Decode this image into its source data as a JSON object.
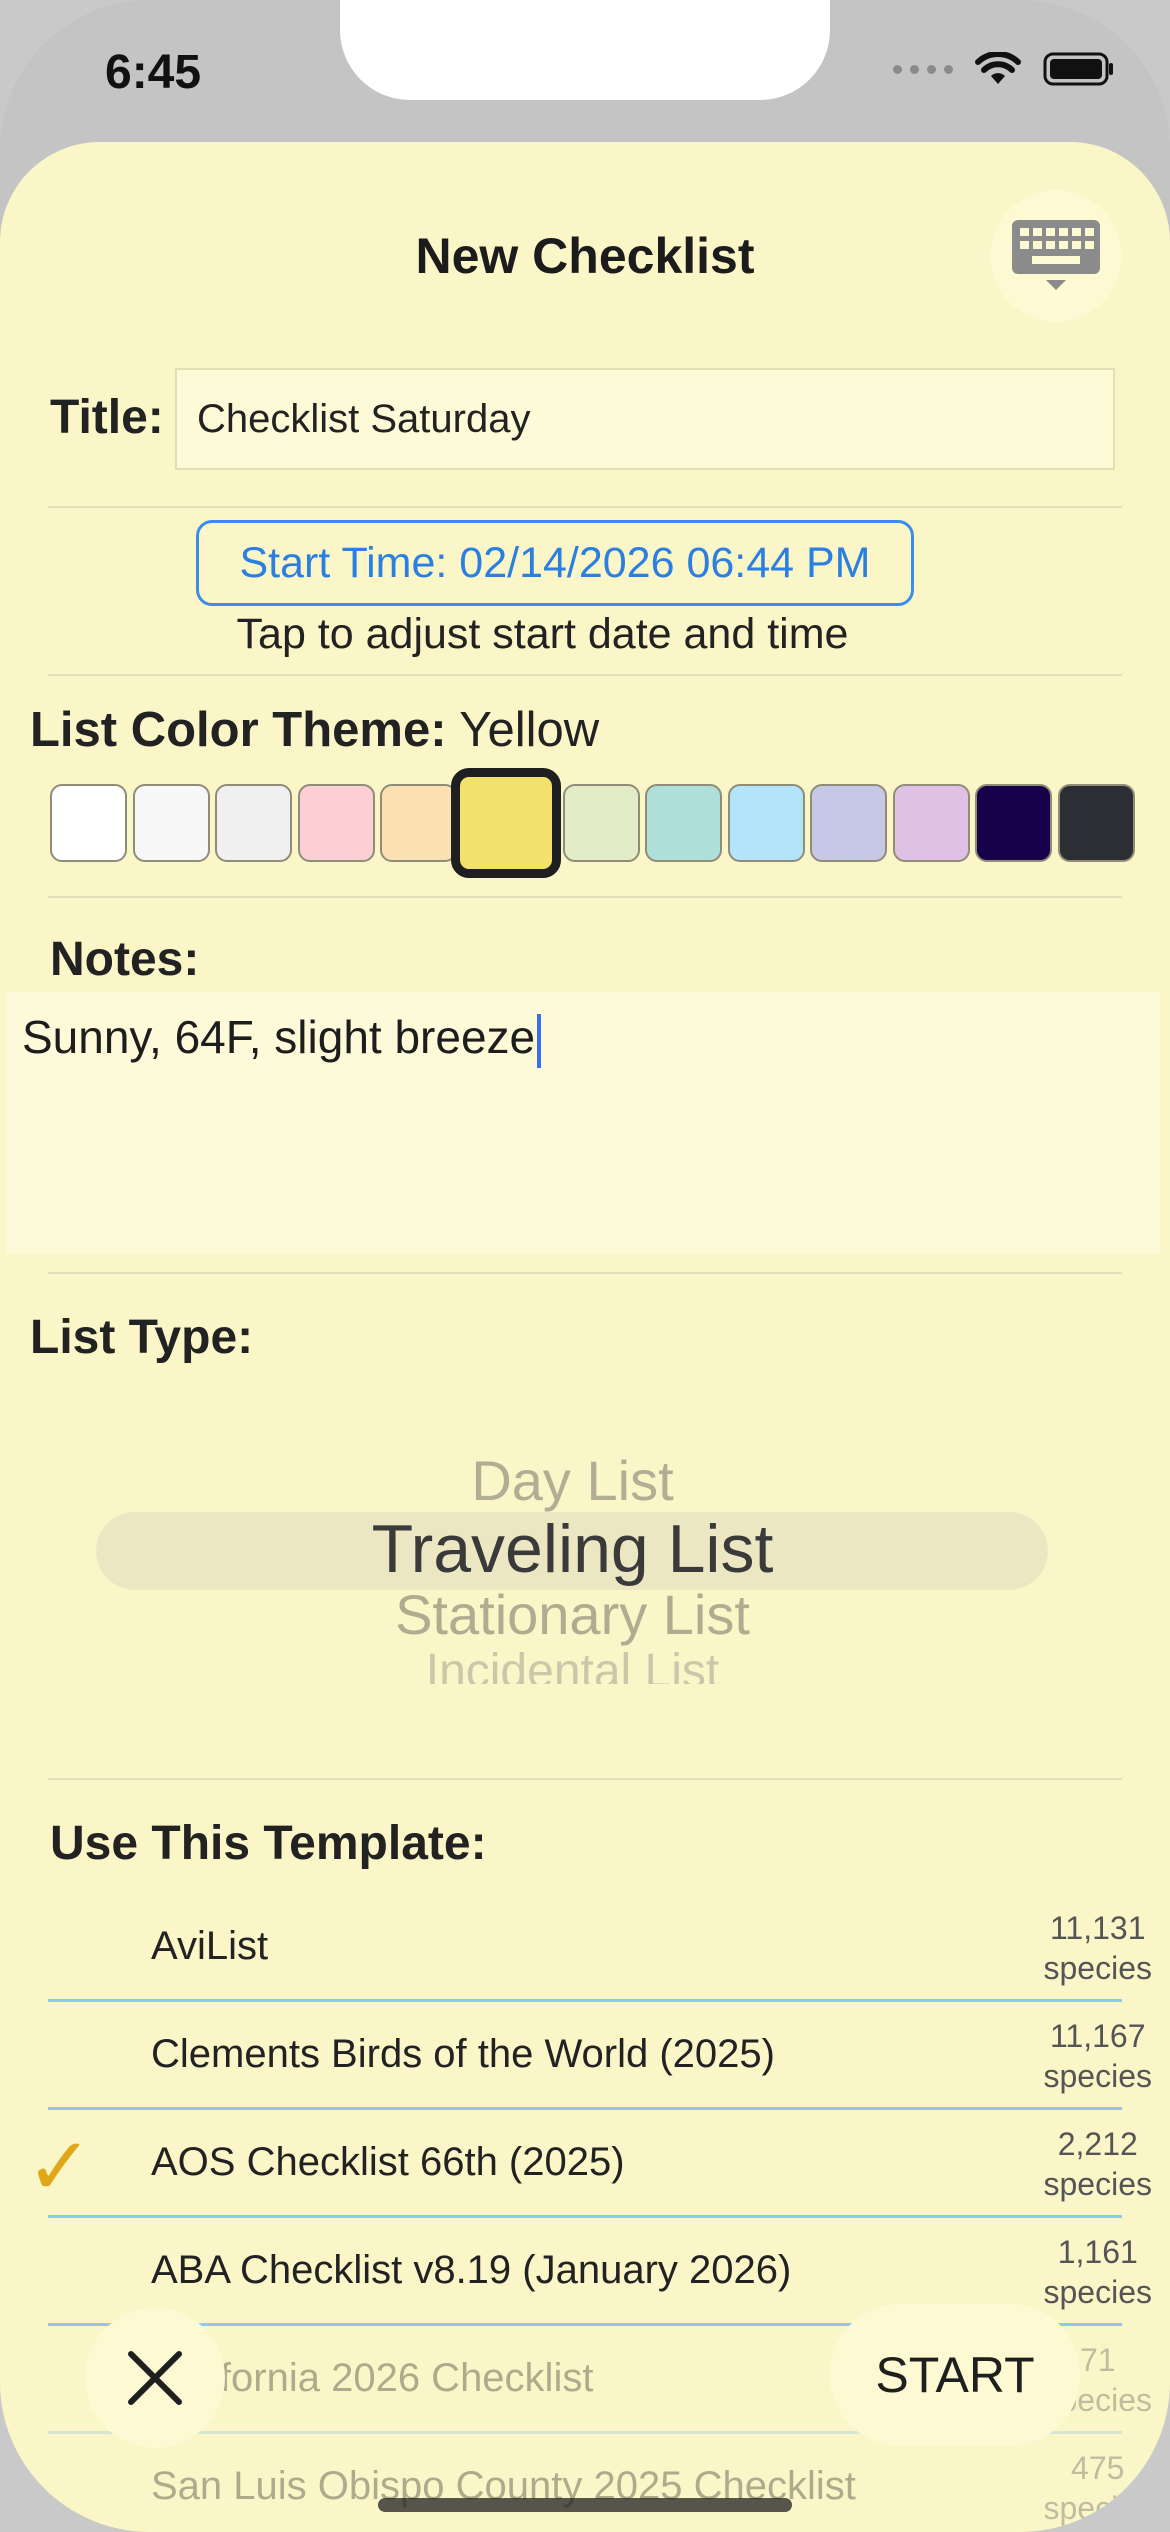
{
  "status_bar": {
    "time": "6:45"
  },
  "sheet": {
    "title": "New Checklist",
    "title_label": "Title:",
    "title_value": "Checklist Saturday",
    "start_time_button": "Start Time: 02/14/2026 06:44 PM",
    "start_time_hint": "Tap to adjust start date and time",
    "color_theme_label": "List Color Theme:",
    "color_theme_value": "Yellow",
    "color_swatches": [
      "#ffffff",
      "#f7f7f7",
      "#f0f0f0",
      "#fbcfd4",
      "#fbe0b2",
      "#f2e16d",
      "#e2edc8",
      "#afdfd9",
      "#b2e5fb",
      "#c6c8e6",
      "#e0c1e6",
      "#19004a",
      "#2c2e33"
    ],
    "selected_swatch_index": 5,
    "notes_label": "Notes:",
    "notes_value": "Sunny, 64F, slight breeze",
    "list_type_label": "List Type:",
    "list_types": [
      "Day List",
      "Traveling List",
      "Stationary List",
      "Incidental List"
    ],
    "selected_list_type": "Traveling List",
    "template_label": "Use This Template:",
    "templates": [
      {
        "name": "AviList",
        "count": "11,131",
        "unit": "species",
        "selected": false
      },
      {
        "name": "Clements Birds of the World (2025)",
        "count": "11,167",
        "unit": "species",
        "selected": false
      },
      {
        "name": "AOS Checklist 66th (2025)",
        "count": "2,212",
        "unit": "species",
        "selected": true
      },
      {
        "name": "ABA Checklist v8.19 (January 2026)",
        "count": "1,161",
        "unit": "species",
        "selected": false
      },
      {
        "name": "California 2026 Checklist",
        "count": "71",
        "unit": "species",
        "selected": false
      },
      {
        "name": "San Luis Obispo County 2025 Checklist",
        "count": "475",
        "unit": "species",
        "selected": false
      }
    ],
    "start_label": "START"
  },
  "icons": {
    "keyboard": "keyboard-dismiss-icon",
    "close": "close-icon",
    "check": "checkmark-icon"
  },
  "colors": {
    "sheet_bg": "#fbf6c8",
    "accent_blue": "#2a7fe0",
    "check_gold": "#e0a718"
  }
}
